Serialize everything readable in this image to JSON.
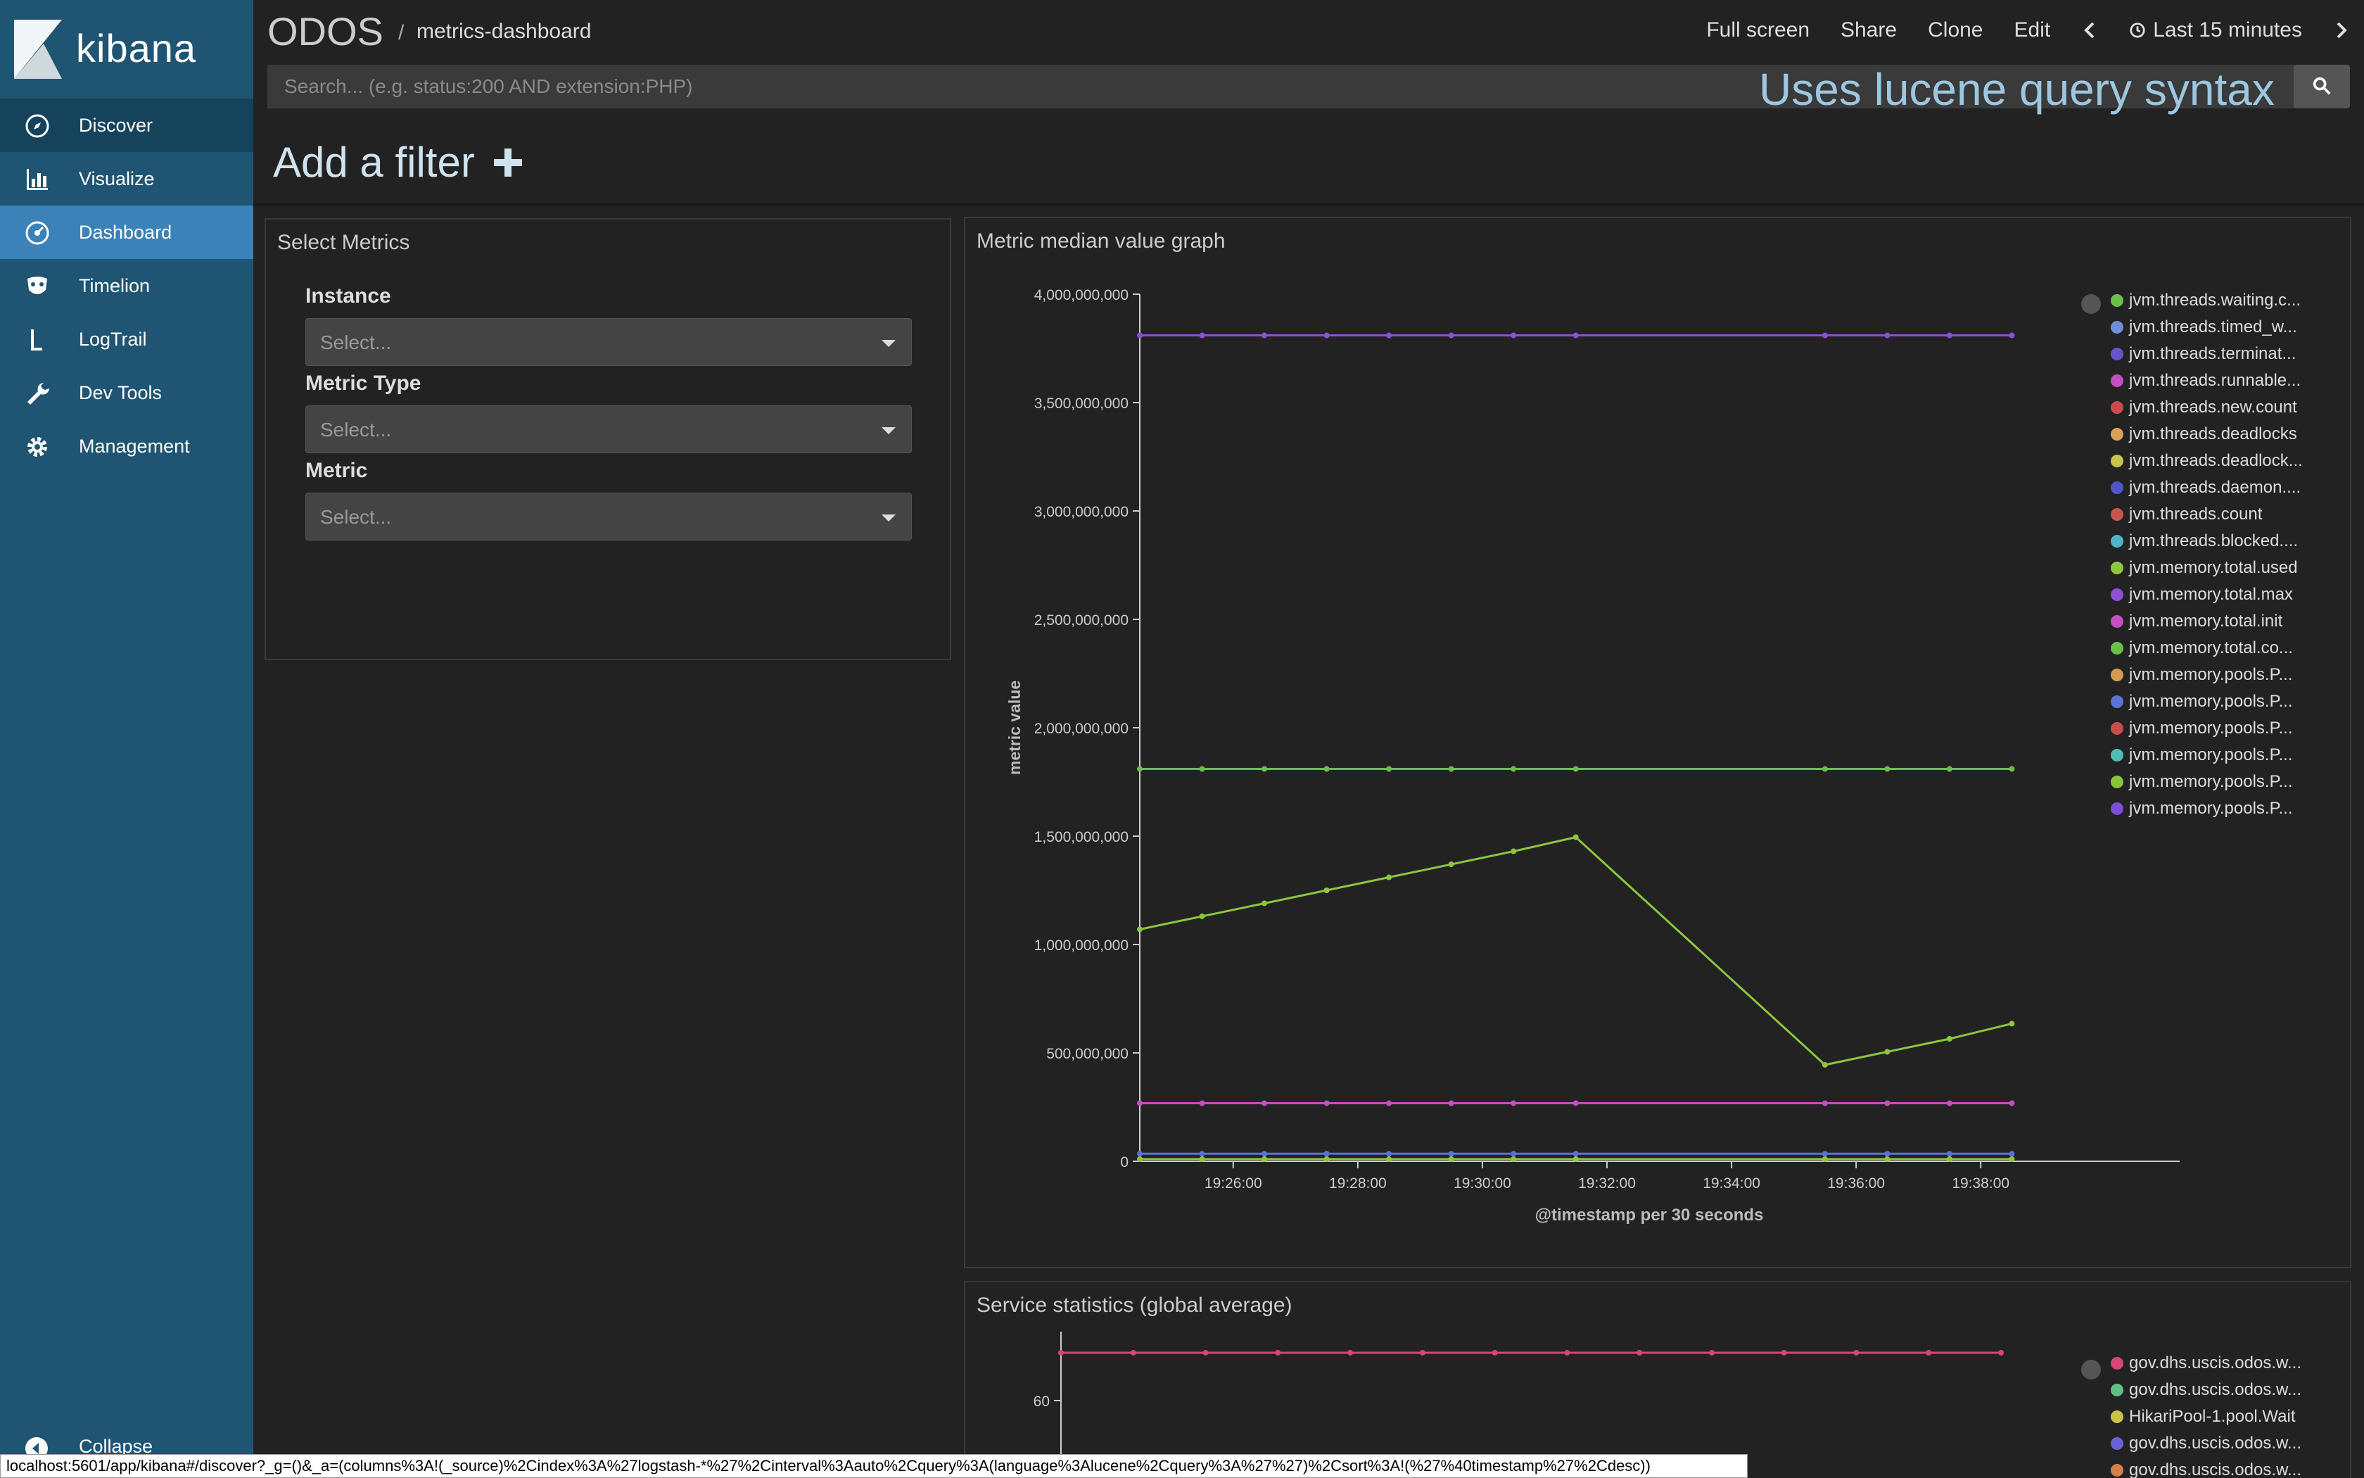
{
  "sidebar": {
    "logo_text": "kibana",
    "items": [
      {
        "label": "Discover",
        "icon": "compass-icon"
      },
      {
        "label": "Visualize",
        "icon": "bar-chart-icon"
      },
      {
        "label": "Dashboard",
        "icon": "dashboard-gauge-icon"
      },
      {
        "label": "Timelion",
        "icon": "timelion-mask-icon"
      },
      {
        "label": "LogTrail",
        "icon": "logtrail-icon"
      },
      {
        "label": "Dev Tools",
        "icon": "wrench-icon"
      },
      {
        "label": "Management",
        "icon": "gear-icon"
      }
    ],
    "collapse_label": "Collapse"
  },
  "header": {
    "app_title": "ODOS",
    "separator": "/",
    "breadcrumb": "metrics-dashboard",
    "menu": {
      "full_screen": "Full screen",
      "share": "Share",
      "clone": "Clone",
      "edit": "Edit",
      "time_range": "Last 15 minutes"
    }
  },
  "search": {
    "placeholder": "Search... (e.g. status:200 AND extension:PHP)",
    "hint": "Uses lucene query syntax"
  },
  "filter": {
    "label": "Add a filter"
  },
  "select_metrics": {
    "title": "Select Metrics",
    "fields": [
      {
        "label": "Instance",
        "placeholder": "Select..."
      },
      {
        "label": "Metric Type",
        "placeholder": "Select..."
      },
      {
        "label": "Metric",
        "placeholder": "Select..."
      }
    ]
  },
  "chart1": {
    "title": "Metric median value graph"
  },
  "chart2": {
    "title": "Service statistics (global average)"
  },
  "chart_data": [
    {
      "type": "line",
      "ylabel": "metric value",
      "xlabel": "@timestamp per 30 seconds",
      "ylim": [
        0,
        4000000000
      ],
      "y_ticks": [
        "0",
        "500,000,000",
        "1,000,000,000",
        "1,500,000,000",
        "2,000,000,000",
        "2,500,000,000",
        "3,000,000,000",
        "3,500,000,000",
        "4,000,000,000"
      ],
      "x_ticks": [
        "19:26:00",
        "19:28:00",
        "19:30:00",
        "19:32:00",
        "19:34:00",
        "19:36:00",
        "19:38:00"
      ],
      "x": [
        "19:24:30",
        "19:25:30",
        "19:26:30",
        "19:27:30",
        "19:28:30",
        "19:29:30",
        "19:30:30",
        "19:31:30",
        "19:35:30",
        "19:36:30",
        "19:37:30",
        "19:38:30"
      ],
      "series": [
        {
          "name": "jvm.memory.total.max",
          "color": "#8f4fd6",
          "values": [
            3810000000,
            3810000000,
            3810000000,
            3810000000,
            3810000000,
            3810000000,
            3810000000,
            3810000000,
            3810000000,
            3810000000,
            3810000000,
            3810000000
          ]
        },
        {
          "name": "jvm.memory.total.co...",
          "color": "#6abf4b",
          "values": [
            1810000000,
            1810000000,
            1810000000,
            1810000000,
            1810000000,
            1810000000,
            1810000000,
            1810000000,
            1810000000,
            1810000000,
            1810000000,
            1810000000
          ]
        },
        {
          "name": "jvm.memory.total.used",
          "color": "#8cc63f",
          "values": [
            1070000000,
            1130000000,
            1190000000,
            1250000000,
            1310000000,
            1370000000,
            1430000000,
            1495000000,
            445000000,
            505000000,
            565000000,
            635000000
          ]
        },
        {
          "name": "jvm.memory.total.init",
          "color": "#c64fc1",
          "values": [
            268000000,
            268000000,
            268000000,
            268000000,
            268000000,
            268000000,
            268000000,
            268000000,
            268000000,
            268000000,
            268000000,
            268000000
          ]
        },
        {
          "name": "jvm.memory.pools.P...",
          "color": "#5b72d9",
          "values": [
            35000000,
            35000000,
            35000000,
            35000000,
            35000000,
            35000000,
            35000000,
            35000000,
            35000000,
            35000000,
            35000000,
            35000000
          ]
        },
        {
          "name": "jvm.memory.pools.P...",
          "color": "#89c43c",
          "values": [
            10000000,
            10000000,
            10000000,
            10000000,
            10000000,
            10000000,
            10000000,
            10000000,
            10000000,
            10000000,
            10000000,
            10000000
          ]
        }
      ],
      "legend": [
        {
          "name": "jvm.threads.waiting.c...",
          "color": "#6abf4b"
        },
        {
          "name": "jvm.threads.timed_w...",
          "color": "#6f8fd9"
        },
        {
          "name": "jvm.threads.terminat...",
          "color": "#6a52c9"
        },
        {
          "name": "jvm.threads.runnable...",
          "color": "#c64fc1"
        },
        {
          "name": "jvm.threads.new.count",
          "color": "#c94c4c"
        },
        {
          "name": "jvm.threads.deadlocks",
          "color": "#dca05b"
        },
        {
          "name": "jvm.threads.deadlock...",
          "color": "#c8c34a"
        },
        {
          "name": "jvm.threads.daemon....",
          "color": "#5056c9"
        },
        {
          "name": "jvm.threads.count",
          "color": "#c9554e"
        },
        {
          "name": "jvm.threads.blocked....",
          "color": "#4cb5c9"
        },
        {
          "name": "jvm.memory.total.used",
          "color": "#8cc63f"
        },
        {
          "name": "jvm.memory.total.max",
          "color": "#8f4fd6"
        },
        {
          "name": "jvm.memory.total.init",
          "color": "#c64fc1"
        },
        {
          "name": "jvm.memory.total.co...",
          "color": "#6abf4b"
        },
        {
          "name": "jvm.memory.pools.P...",
          "color": "#d49a52"
        },
        {
          "name": "jvm.memory.pools.P...",
          "color": "#5b72d9"
        },
        {
          "name": "jvm.memory.pools.P...",
          "color": "#c94c4c"
        },
        {
          "name": "jvm.memory.pools.P...",
          "color": "#4cbdb7"
        },
        {
          "name": "jvm.memory.pools.P...",
          "color": "#89c43c"
        },
        {
          "name": "jvm.memory.pools.P...",
          "color": "#7a4fd6"
        }
      ]
    },
    {
      "type": "line",
      "y_ticks": [
        "60"
      ],
      "series": [
        {
          "name": "gov.dhs.uscis.odos.w...",
          "color": "#d6457a",
          "values": [
            68,
            68,
            68,
            68,
            68,
            68,
            68,
            68,
            68,
            68,
            68,
            68,
            68,
            68
          ]
        }
      ],
      "legend": [
        {
          "name": "gov.dhs.uscis.odos.w...",
          "color": "#d6457a"
        },
        {
          "name": "gov.dhs.uscis.odos.w...",
          "color": "#5fbf85"
        },
        {
          "name": "HikariPool-1.pool.Wait",
          "color": "#c8c34a"
        },
        {
          "name": "gov.dhs.uscis.odos.w...",
          "color": "#6b61d6"
        },
        {
          "name": "gov.dhs.uscis.odos.w...",
          "color": "#d4804a"
        }
      ]
    }
  ],
  "statusbar": {
    "url": "localhost:5601/app/kibana#/discover?_g=()&_a=(columns%3A!(_source)%2Cindex%3A%27logstash-*%27%2Cinterval%3Aauto%2Cquery%3A(language%3Alucene%2Cquery%3A%27%27)%2Csort%3A!(%27%40timestamp%27%2Cdesc))"
  },
  "colors": {
    "sidebar_bg": "#1f5573",
    "sidebar_active": "#3b82b8",
    "page_bg": "#222222",
    "hint_color": "#9cc7e0"
  }
}
